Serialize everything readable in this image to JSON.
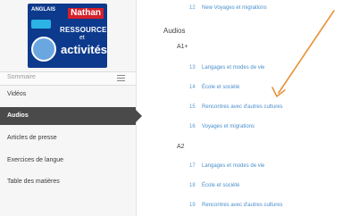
{
  "sidebar": {
    "cover": {
      "top_text": "ANGLAIS",
      "brand": "Nathan",
      "line1": "RESSOURCES",
      "line2": "et",
      "line3": "activités"
    },
    "summary_label": "Sommaire",
    "items": [
      {
        "label": "Vidéos",
        "active": false
      },
      {
        "label": "Audios",
        "active": true
      },
      {
        "label": "Articles de presse",
        "active": false
      },
      {
        "label": "Exercices de langue",
        "active": false
      },
      {
        "label": "Table des matières",
        "active": false
      }
    ]
  },
  "main": {
    "top_link": {
      "num": "12",
      "title": "New Voyages et migrations"
    },
    "section_title": "Audios",
    "groups": [
      {
        "label": "A1+",
        "items": [
          {
            "num": "13",
            "title": "Langages et modes de vie"
          },
          {
            "num": "14",
            "title": "École et société"
          },
          {
            "num": "15",
            "title": "Rencontres avec d'autres cultures"
          },
          {
            "num": "16",
            "title": "Voyages et migrations"
          }
        ]
      },
      {
        "label": "A2",
        "items": [
          {
            "num": "17",
            "title": "Langages et modes de vie"
          },
          {
            "num": "18",
            "title": "École et société"
          },
          {
            "num": "19",
            "title": "Rencontres avec d'autres cultures"
          }
        ]
      }
    ]
  },
  "colors": {
    "arrow": "#e8923a",
    "link": "#4a8fcb",
    "active_bg": "#4a4a4a"
  }
}
